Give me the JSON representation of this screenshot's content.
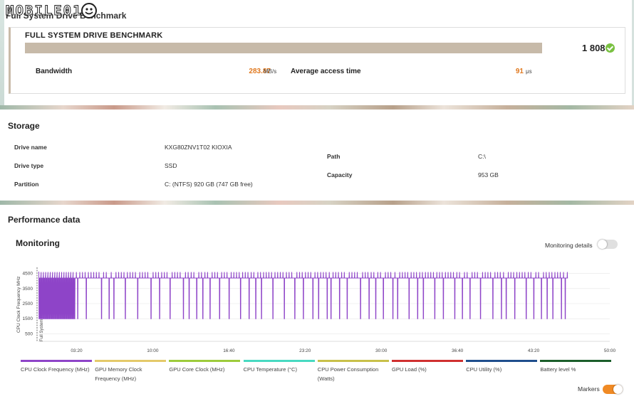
{
  "logo": {
    "text": "MOBILE01"
  },
  "top_title": "Full System Drive Benchmark",
  "benchmark": {
    "title": "FULL SYSTEM DRIVE BENCHMARK",
    "score": "1 808",
    "bandwidth_label": "Bandwidth",
    "bandwidth_value": "283.87",
    "bandwidth_unit": "MB/s",
    "access_label": "Average access time",
    "access_value": "91",
    "access_unit": "μs",
    "colors": {
      "bar": "#c7baa9",
      "value": "#e0781e",
      "check": "#7ac142"
    }
  },
  "storage": {
    "title": "Storage",
    "drive_name_label": "Drive name",
    "drive_name": "KXG80ZNV1T02 KIOXIA",
    "drive_type_label": "Drive type",
    "drive_type": "SSD",
    "partition_label": "Partition",
    "partition": "C: (NTFS) 920 GB (747 GB free)",
    "path_label": "Path",
    "path": "C:\\",
    "capacity_label": "Capacity",
    "capacity": "953 GB"
  },
  "performance": {
    "title": "Performance data",
    "monitoring_title": "Monitoring",
    "monitoring_details_label": "Monitoring details",
    "monitoring_details_on": false,
    "markers_label": "Markers",
    "markers_on": true
  },
  "chart_data": {
    "type": "line",
    "ylabel": "CPU Clock Frequency MHz",
    "marker_label": "Full System Drive Benchmark",
    "y_ticks": [
      "4500",
      "3500",
      "2500",
      "1500",
      "500"
    ],
    "x_ticks": [
      "03:20",
      "10:00",
      "16:40",
      "23:20",
      "30:00",
      "36:40",
      "43:20",
      "50:00"
    ],
    "xlim_seconds": [
      0,
      3000
    ],
    "ylim": [
      0,
      5000
    ],
    "series": [
      {
        "name": "CPU Clock Frequency (MHz)",
        "color": "#8e44c8",
        "high_mhz": 4200,
        "peak_mhz": 4600,
        "low_mhz": 1500,
        "drops_seconds": [
          4,
          46,
          62,
          74,
          99,
          118,
          140,
          168,
          205,
          250,
          330,
          370,
          395,
          455,
          520,
          590,
          635,
          690,
          760,
          790,
          830,
          862,
          900,
          950,
          1000,
          1060,
          1105,
          1140,
          1170,
          1230,
          1290,
          1345,
          1390,
          1440,
          1470,
          1515,
          1535,
          1580,
          1620,
          1690,
          1735,
          1770,
          1810,
          1860,
          1885,
          1945,
          1990,
          2020,
          2080,
          2125,
          2185,
          2225,
          2265,
          2320,
          2385,
          2430,
          2455,
          2500,
          2560,
          2600,
          2640,
          2670,
          2700,
          2745,
          2765
        ],
        "dense_low_until_seconds": 190,
        "end_seconds": 2780
      }
    ],
    "legend": [
      {
        "name": "CPU Clock Frequency (MHz)",
        "color": "#8e44c8"
      },
      {
        "name": "GPU Memory Clock Frequency (MHz)",
        "color": "#e4c96a"
      },
      {
        "name": "GPU Core Clock (MHz)",
        "color": "#9dcb3c"
      },
      {
        "name": "CPU Temperature (°C)",
        "color": "#48d9c1"
      },
      {
        "name": "CPU Power Consumption (Watts)",
        "color": "#c8c04a"
      },
      {
        "name": "GPU Load (%)",
        "color": "#d03030"
      },
      {
        "name": "CPU Utility (%)",
        "color": "#1f4e8c"
      },
      {
        "name": "Battery level %",
        "color": "#1b5e2a"
      }
    ]
  }
}
